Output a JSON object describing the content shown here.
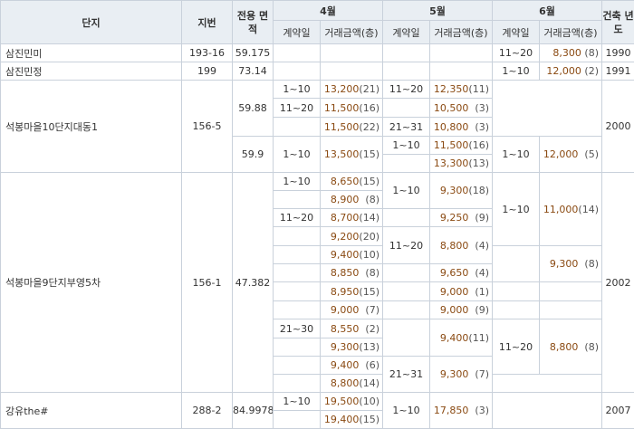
{
  "headers": {
    "complex": "단지",
    "lot": "지번",
    "area": "전용 면적",
    "months": [
      "4월",
      "5월",
      "6월"
    ],
    "built": "건축 년도",
    "contract_day": "계약일",
    "amount": "거래금액(층)"
  },
  "rows": [
    {
      "complex": "삼진민미",
      "lot": "193-16",
      "area": "59.175",
      "jun_day": "11~20",
      "jun_amt": "8,300",
      "jun_fl": "(8)",
      "built": "1990"
    },
    {
      "complex": "삼진민정",
      "lot": "199",
      "area": "73.14",
      "jun_day": "1~10",
      "jun_amt": "12,000",
      "jun_fl": "(2)",
      "built": "1991"
    },
    {
      "complex": "석봉마을10단지대동1",
      "lot": "156-5",
      "built": "2000",
      "sub": [
        {
          "area": "59.88",
          "apr": [
            {
              "day": "1~10",
              "amt": "13,200",
              "fl": "(21)"
            },
            {
              "day": "11~20",
              "amt": "11,500",
              "fl": "(16)"
            },
            {
              "day": "",
              "amt": "11,500",
              "fl": "(22)"
            }
          ],
          "may": [
            {
              "day": "11~20",
              "amt": "12,350",
              "fl": "(11)"
            },
            {
              "day": "",
              "amt": "10,500",
              "fl": "(3)"
            },
            {
              "day": "21~31",
              "amt": "10,800",
              "fl": "(3)"
            }
          ]
        },
        {
          "area": "59.9",
          "apr": [
            {
              "day": "1~10",
              "amt": "13,500",
              "fl": "(15)"
            }
          ],
          "may": [
            {
              "day": "1~10",
              "amt": "11,500",
              "fl": "(16)"
            },
            {
              "day": "",
              "amt": "13,300",
              "fl": "(13)"
            }
          ],
          "jun": [
            {
              "day": "1~10",
              "amt": "12,000",
              "fl": "(5)"
            }
          ]
        }
      ]
    },
    {
      "complex": "석봉마을9단지부영5차",
      "lot": "156-1",
      "area": "47.382",
      "built": "2002",
      "apr": [
        {
          "day": "1~10",
          "amt": "8,650",
          "fl": "(15)"
        },
        {
          "day": "",
          "amt": "8,900",
          "fl": "(8)"
        },
        {
          "day": "11~20",
          "amt": "8,700",
          "fl": "(14)"
        },
        {
          "day": "",
          "amt": "9,200",
          "fl": "(20)"
        },
        {
          "day": "",
          "amt": "9,400",
          "fl": "(10)"
        },
        {
          "day": "",
          "amt": "8,850",
          "fl": "(8)"
        },
        {
          "day": "",
          "amt": "8,950",
          "fl": "(15)"
        },
        {
          "day": "",
          "amt": "9,000",
          "fl": "(7)"
        },
        {
          "day": "21~30",
          "amt": "8,550",
          "fl": "(2)"
        },
        {
          "day": "",
          "amt": "9,300",
          "fl": "(13)"
        },
        {
          "day": "",
          "amt": "9,400",
          "fl": "(6)"
        },
        {
          "day": "",
          "amt": "8,800",
          "fl": "(14)"
        }
      ],
      "may": [
        {
          "day": "1~10",
          "amt": "9,300",
          "fl": "(18)"
        },
        {
          "day": "",
          "amt": "9,250",
          "fl": "(9)"
        },
        {
          "day": "11~20",
          "amt": "8,800",
          "fl": "(4)"
        },
        {
          "day": "",
          "amt": "9,650",
          "fl": "(4)"
        },
        {
          "day": "",
          "amt": "9,000",
          "fl": "(1)"
        },
        {
          "day": "",
          "amt": "9,000",
          "fl": "(9)"
        },
        {
          "day": "",
          "amt": "9,400",
          "fl": "(11)"
        },
        {
          "day": "21~31",
          "amt": "9,300",
          "fl": "(7)"
        }
      ],
      "jun": [
        {
          "day": "1~10",
          "amt": "11,000",
          "fl": "(14)"
        },
        {
          "day": "",
          "amt": "9,300",
          "fl": "(8)"
        },
        {
          "day": "11~20",
          "amt": "8,800",
          "fl": "(8)"
        }
      ]
    },
    {
      "complex": "강유the#",
      "lot": "288-2",
      "area": "84.9978",
      "built": "2007",
      "apr": [
        {
          "day": "1~10",
          "amt": "19,500",
          "fl": "(10)"
        },
        {
          "day": "",
          "amt": "19,400",
          "fl": "(15)"
        }
      ],
      "may": [
        {
          "day": "1~10",
          "amt": "17,850",
          "fl": "(3)"
        }
      ]
    }
  ]
}
